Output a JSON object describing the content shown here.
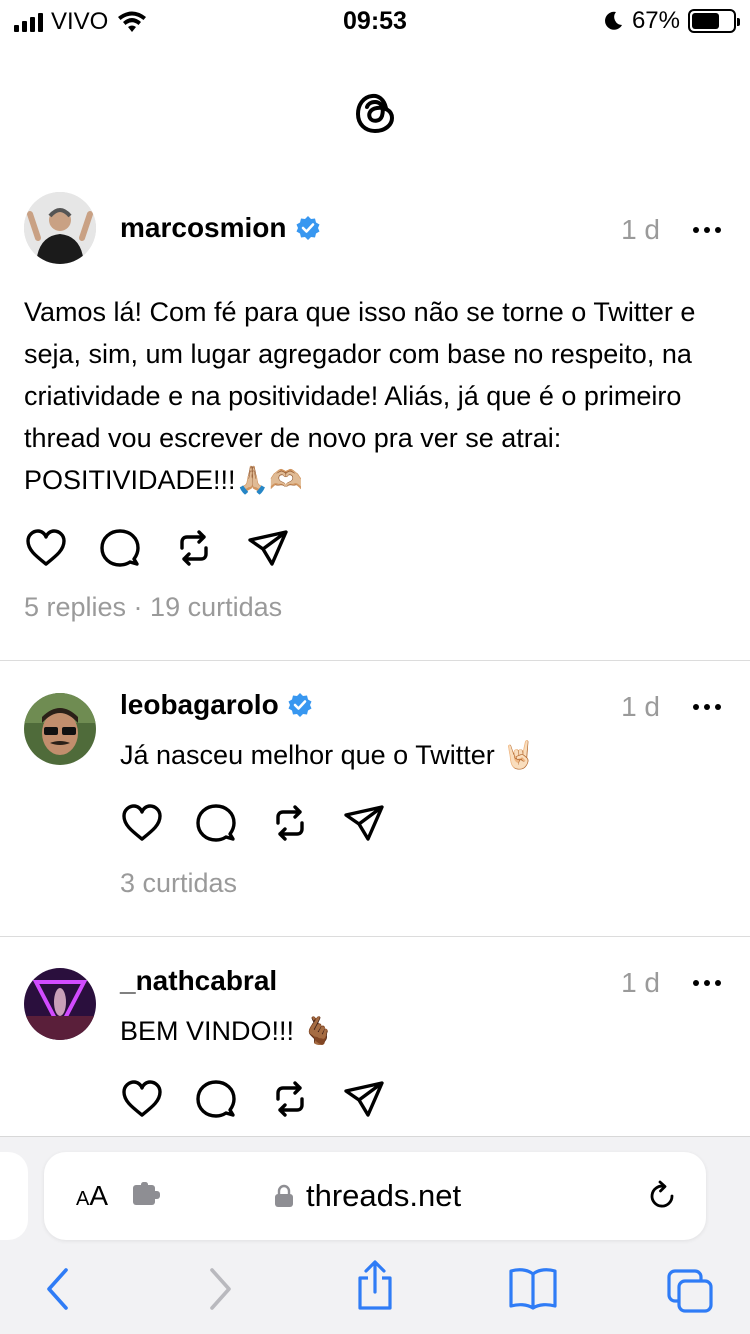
{
  "status_bar": {
    "carrier": "VIVO",
    "time": "09:53",
    "battery": "67%",
    "battery_level": 0.67
  },
  "app": {
    "logo": "threads-logo"
  },
  "posts": [
    {
      "username": "marcosmion",
      "verified": true,
      "time": "1 d",
      "text": "Vamos lá! Com fé para que isso não se torne o Twitter e seja, sim, um lugar agregador com base no respeito, na criatividade e na positividade! Aliás, já que é o primeiro thread vou escrever de novo pra ver se atrai: POSITIVIDADE!!!🙏🏼🫶🏼",
      "stats": "5 replies · 19 curtidas"
    },
    {
      "username": "leobagarolo",
      "verified": true,
      "time": "1 d",
      "text": "Já nasceu melhor que o Twitter 🤘🏻",
      "stats": "3 curtidas"
    },
    {
      "username": "_nathcabral",
      "verified": false,
      "time": "1 d",
      "text": "BEM VINDO!!! 🫰🏾",
      "stats": ""
    }
  ],
  "browser": {
    "text_size_label": "AA",
    "url": "threads.net",
    "nav_icons": [
      "back-icon",
      "forward-icon",
      "share-icon",
      "bookmarks-icon",
      "tabs-icon"
    ]
  },
  "colors": {
    "verified": "#3897f0",
    "muted": "#9a9a9a",
    "link": "#2f7cf6"
  }
}
